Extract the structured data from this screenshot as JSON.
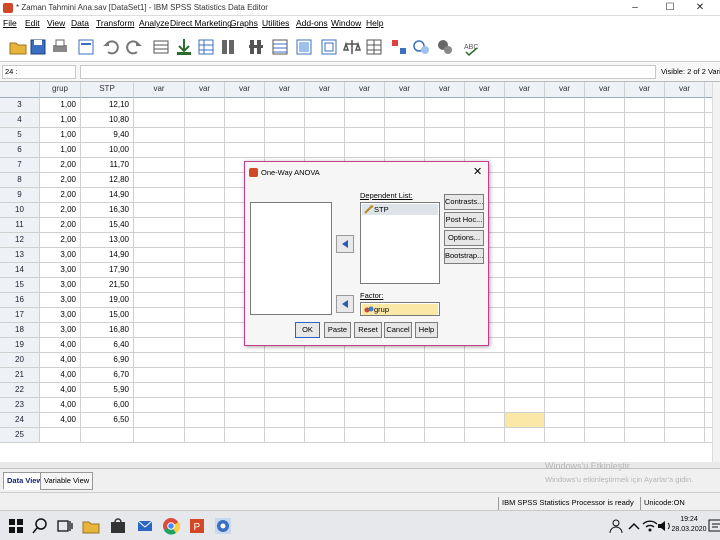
{
  "window": {
    "title": "* Zaman Tahmini Ana.sav [DataSet1] - IBM SPSS Statistics Data Editor",
    "controls": [
      "–",
      "☐",
      "✕"
    ]
  },
  "menubar": [
    "File",
    "Edit",
    "View",
    "Data",
    "Transform",
    "Analyze",
    "Direct Marketing",
    "Graphs",
    "Utilities",
    "Add-ons",
    "Window",
    "Help"
  ],
  "cellbar": {
    "cell_ref": "24 :",
    "visible": "Visible: 2 of 2 Variab"
  },
  "grid": {
    "columns": [
      "grup",
      "STP",
      "var",
      "var",
      "var",
      "var",
      "var",
      "var",
      "var",
      "var",
      "var",
      "var",
      "var",
      "var",
      "var",
      "var",
      "var"
    ],
    "rows": [
      {
        "n": "3",
        "grup": "1,00",
        "stp": "12,10"
      },
      {
        "n": "4",
        "grup": "1,00",
        "stp": "10,80"
      },
      {
        "n": "5",
        "grup": "1,00",
        "stp": "9,40"
      },
      {
        "n": "6",
        "grup": "1,00",
        "stp": "10,00"
      },
      {
        "n": "7",
        "grup": "2,00",
        "stp": "11,70"
      },
      {
        "n": "8",
        "grup": "2,00",
        "stp": "12,80"
      },
      {
        "n": "9",
        "grup": "2,00",
        "stp": "14,90"
      },
      {
        "n": "10",
        "grup": "2,00",
        "stp": "16,30"
      },
      {
        "n": "11",
        "grup": "2,00",
        "stp": "15,40"
      },
      {
        "n": "12",
        "grup": "2,00",
        "stp": "13,00"
      },
      {
        "n": "13",
        "grup": "3,00",
        "stp": "14,90"
      },
      {
        "n": "14",
        "grup": "3,00",
        "stp": "17,90"
      },
      {
        "n": "15",
        "grup": "3,00",
        "stp": "21,50"
      },
      {
        "n": "16",
        "grup": "3,00",
        "stp": "19,00"
      },
      {
        "n": "17",
        "grup": "3,00",
        "stp": "15,00"
      },
      {
        "n": "18",
        "grup": "3,00",
        "stp": "16,80"
      },
      {
        "n": "19",
        "grup": "4,00",
        "stp": "6,40"
      },
      {
        "n": "20",
        "grup": "4,00",
        "stp": "6,90"
      },
      {
        "n": "21",
        "grup": "4,00",
        "stp": "6,70"
      },
      {
        "n": "22",
        "grup": "4,00",
        "stp": "5,90"
      },
      {
        "n": "23",
        "grup": "4,00",
        "stp": "6,00"
      },
      {
        "n": "24",
        "grup": "4,00",
        "stp": "6,50"
      },
      {
        "n": "25",
        "grup": "",
        "stp": ""
      }
    ]
  },
  "dialog": {
    "title": "One-Way ANOVA",
    "close": "✕",
    "dependent_label": "Dependent List:",
    "dependent_items": [
      "STP"
    ],
    "factor_label": "Factor:",
    "factor_value": "grup",
    "side_buttons": [
      "Contrasts...",
      "Post Hoc...",
      "Options...",
      "Bootstrap..."
    ],
    "bottom_buttons": [
      "OK",
      "Paste",
      "Reset",
      "Cancel",
      "Help"
    ]
  },
  "tabs": [
    "Data View",
    "Variable View"
  ],
  "activation": {
    "line1": "Windows'u Etkinleştir",
    "line2": "Windows'u etkinleştirmek için Ayarlar'a gidin."
  },
  "status": {
    "processor": "IBM SPSS Statistics Processor is ready",
    "unicode": "Unicode:ON"
  },
  "clock": {
    "time": "19:24",
    "date": "28.03.2020"
  },
  "icons": {
    "toolbar": [
      "open-file-icon",
      "save-icon",
      "print-icon",
      "dialog-recall-icon",
      "undo-icon",
      "redo-icon",
      "goto-case-icon",
      "goto-variable-icon",
      "variables-icon",
      "find-icon",
      "insert-cases-icon",
      "insert-variable-icon",
      "split-file-icon",
      "weight-cases-icon",
      "select-cases-icon",
      "value-labels-icon",
      "use-sets-icon",
      "show-all-icon",
      "spelling-icon"
    ],
    "taskbar": [
      "windows-start-icon",
      "search-icon",
      "task-view-icon",
      "file-explorer-icon",
      "store-icon",
      "mail-icon",
      "chrome-icon",
      "powerpoint-icon",
      "spss-icon"
    ]
  },
  "colors": {
    "dialog_border": "#c43e8c",
    "highlight": "#fbe7a6",
    "header_bg": "#eef1f6",
    "tab_active": "#12237a"
  }
}
